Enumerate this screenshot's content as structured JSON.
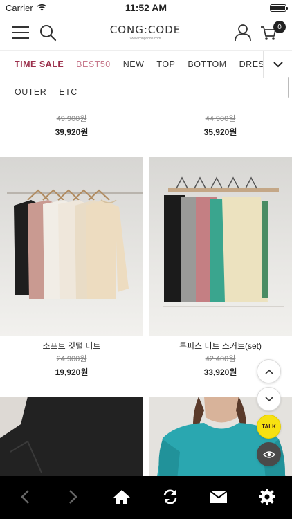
{
  "status_bar": {
    "carrier": "Carrier",
    "time": "11:52 AM"
  },
  "header": {
    "logo": "CONG:CODE",
    "logo_sub": "www.congcode.com",
    "cart_count": "0"
  },
  "categories": {
    "row1": [
      "TIME SALE",
      "BEST50",
      "NEW",
      "TOP",
      "BOTTOM",
      "DRESS"
    ],
    "row2": [
      "OUTER",
      "ETC"
    ]
  },
  "products": [
    {
      "name": "",
      "price_old": "49,900원",
      "price_new": "39,920원"
    },
    {
      "name": "",
      "price_old": "44,900원",
      "price_new": "35,920원"
    },
    {
      "name": "소프트 깃털 니트",
      "price_old": "24,900원",
      "price_new": "19,920원"
    },
    {
      "name": "투피스 니트 스커트(set)",
      "price_old": "42,400원",
      "price_new": "33,920원"
    }
  ],
  "floating": {
    "talk_label": "TALK"
  },
  "colors": {
    "accent": "#9b2f4b",
    "badge": "#222222",
    "talk": "#f7e111",
    "bottom_bar": "#000000"
  },
  "icons": {
    "menu": "hamburger-icon",
    "search": "search-icon",
    "user": "user-icon",
    "cart": "cart-icon",
    "back": "chevron-left-icon",
    "forward": "chevron-right-icon",
    "home": "home-icon",
    "refresh": "refresh-icon",
    "mail": "mail-icon",
    "settings": "gear-icon"
  }
}
